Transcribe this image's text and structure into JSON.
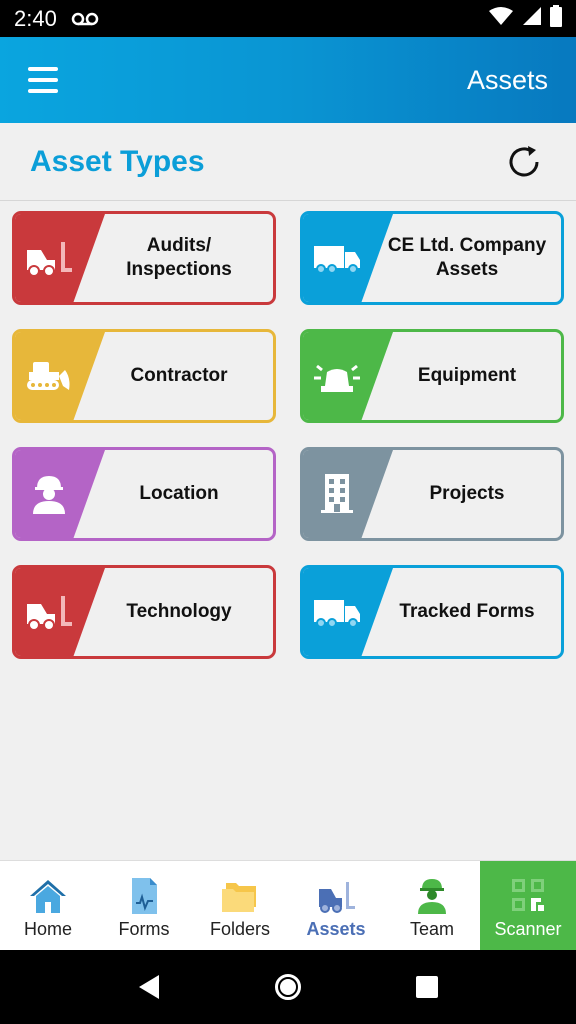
{
  "status_bar": {
    "time": "2:40"
  },
  "app_bar": {
    "title": "Assets",
    "menu_icon": "hamburger-menu-icon"
  },
  "section": {
    "title": "Asset Types",
    "refresh_icon": "refresh-icon"
  },
  "tiles": [
    {
      "label": "Audits/\nInspections",
      "color": "#c9393c",
      "icon": "forklift-icon"
    },
    {
      "label": "CE Ltd. Company\nAssets",
      "color": "#0aa0d9",
      "icon": "truck-icon"
    },
    {
      "label": "Contractor",
      "color": "#e7b73a",
      "icon": "bulldozer-icon"
    },
    {
      "label": "Equipment",
      "color": "#4db848",
      "icon": "siren-icon"
    },
    {
      "label": "Location",
      "color": "#b464c6",
      "icon": "worker-icon"
    },
    {
      "label": "Projects",
      "color": "#7d93a0",
      "icon": "building-icon"
    },
    {
      "label": "Technology",
      "color": "#c9393c",
      "icon": "forklift-icon"
    },
    {
      "label": "Tracked Forms",
      "color": "#0aa0d9",
      "icon": "truck-icon"
    }
  ],
  "bottom_nav": {
    "items": [
      {
        "label": "Home",
        "icon": "home-icon"
      },
      {
        "label": "Forms",
        "icon": "form-icon"
      },
      {
        "label": "Folders",
        "icon": "folders-icon"
      },
      {
        "label": "Assets",
        "icon": "forklift-icon",
        "active": true
      },
      {
        "label": "Team",
        "icon": "worker-icon"
      },
      {
        "label": "Scanner",
        "icon": "qr-code-icon"
      }
    ]
  },
  "colors": {
    "accent": "#0b9ed8",
    "active_nav": "#4b6fb5",
    "scanner_bg": "#4db848"
  }
}
